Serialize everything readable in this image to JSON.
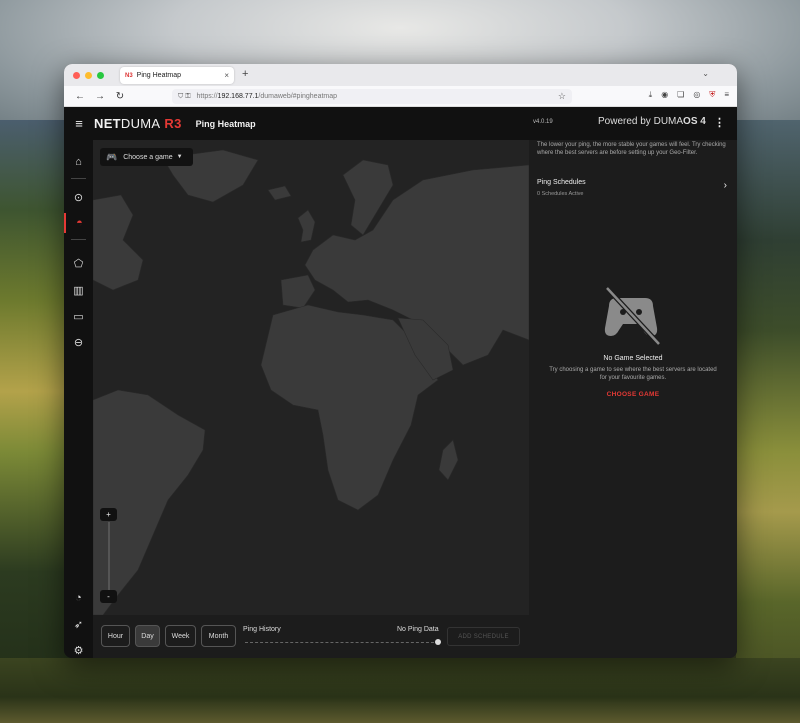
{
  "browser": {
    "tab": {
      "favicon": "N3",
      "title": "Ping Heatmap",
      "close": "×"
    },
    "new_tab": "+",
    "tab_list": "⌄",
    "nav": {
      "back": "←",
      "forward": "→",
      "reload": "↻"
    },
    "url": {
      "prefix": "https://",
      "host": "192.168.77.1",
      "path": "/dumaweb/#pingheatmap"
    },
    "star": "☆"
  },
  "app": {
    "logo": {
      "net": "NET",
      "duma": "DUMA",
      "model": "R3"
    },
    "page_title": "Ping Heatmap",
    "version": "v4.0.19",
    "powered": {
      "prefix": "Powered by ",
      "brand": "DUMA",
      "os": "OS 4"
    },
    "game_select": {
      "label": "Choose a game"
    },
    "zoom": {
      "plus": "+",
      "minus": "-"
    },
    "range_buttons": [
      {
        "label": "Hour",
        "active": false
      },
      {
        "label": "Day",
        "active": true
      },
      {
        "label": "Week",
        "active": false
      },
      {
        "label": "Month",
        "active": false
      }
    ],
    "ping_history": {
      "label": "Ping History",
      "status": "No Ping Data"
    },
    "add_schedule": "ADD SCHEDULE",
    "panel": {
      "description": "The lower your ping, the more stable your games will feel. Try checking where the best servers are before setting up your Geo-Filter.",
      "schedules_title": "Ping Schedules",
      "schedules_count": "0 Schedules Active",
      "no_game_title": "No Game Selected",
      "no_game_desc": "Try choosing a game to see where the best servers are located for your favourite games.",
      "choose_game": "CHOOSE GAME"
    },
    "sidebar_icons": [
      "home-icon",
      "location-pin-icon",
      "ping-heatmap-icon",
      "geo-filter-icon",
      "bar-chart-icon",
      "devices-icon",
      "block-icon",
      "speedometer-icon",
      "rocket-icon",
      "gear-icon"
    ]
  },
  "colors": {
    "accent": "#e53935",
    "background": "#1c1c1c",
    "land": "#3a3a3a"
  }
}
